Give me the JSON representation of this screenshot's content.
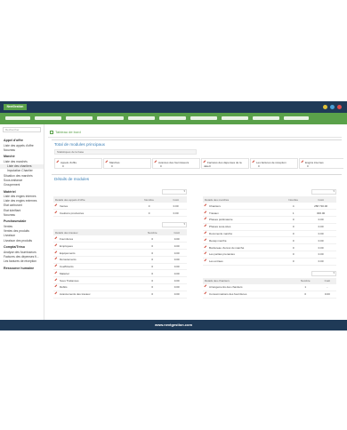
{
  "brand": {
    "name": "NextGestion",
    "accent": "#5aa14a",
    "dark": "#1f3a57"
  },
  "window_dots": [
    "#e0c13a",
    "#4aa0d6",
    "#e14b4b"
  ],
  "sidebar": {
    "search_placeholder": "Rechercher",
    "sections": [
      {
        "title": "Appel d'offre",
        "links": [
          "Liste des appels d'offre",
          "Nouveau"
        ]
      },
      {
        "title": "Marché",
        "links": [
          "Liste des marchés",
          "Liste des chantiers",
          "Imputation Chantier",
          "Situation des marchés",
          "Sous-traitance",
          "Groupement"
        ]
      },
      {
        "title": "Matériel",
        "links": [
          "Liste des engins internes",
          "Liste des engins externes",
          "Etat carburant",
          "Etat lubrifiant",
          "Nouveau"
        ]
      },
      {
        "title": "Purchasesdale",
        "links": [
          "Ventes",
          "Ventes des produits",
          "Livraison",
          "Livraison des produits"
        ]
      },
      {
        "title": "Compta/Tréso",
        "links": [
          "Analyse des fournisseurs",
          "Factures des dépenses fi...",
          "Les factures de réception"
        ]
      },
      {
        "title": "Ressource humaine",
        "links": []
      }
    ]
  },
  "main": {
    "breadcrumb": "Tableau de bord",
    "overview": {
      "title": "Total de modules principaux",
      "hint": "Statistiques de la base",
      "modules": [
        {
          "label": "Appels d'offre",
          "value": "0"
        },
        {
          "label": "Marchés",
          "value": "0"
        },
        {
          "label": "Avances des fournisseurs",
          "value": "0"
        },
        {
          "label": "Factures des dépenses de la date",
          "value": "0"
        },
        {
          "label": "Les factures de réception",
          "value": "0"
        },
        {
          "label": "Engins internes",
          "value": "0"
        },
        {
          "label": "Engins externes",
          "value": "0"
        }
      ]
    },
    "details": {
      "title": "Détails de modules",
      "left_tables": [
        {
          "headers": [
            "Détails des appels d'offre",
            "Nombre",
            "Coût"
          ],
          "rows": [
            [
              "Ventes",
              "0",
              "0.00"
            ],
            [
              "Cautions provisoires",
              "0",
              "0.00"
            ]
          ]
        },
        {
          "headers": [
            "Détails des travaux",
            "Nombre",
            "Coût"
          ],
          "rows": [
            [
              "Fournitures",
              "0",
              "0.00"
            ],
            [
              "Employées",
              "0",
              "0.00"
            ],
            [
              "Equipements",
              "0",
              "0.00"
            ],
            [
              "Déroulements",
              "0",
              "0.00"
            ],
            [
              "Coefficients",
              "0",
              "0.00"
            ],
            [
              "Matériel",
              "0",
              "0.00"
            ],
            [
              "Sous Traitances",
              "0",
              "0.00"
            ],
            [
              "Débits",
              "0",
              "0.00"
            ],
            [
              "Avancements des travaux",
              "0",
              "0.00"
            ]
          ]
        }
      ],
      "right_tables": [
        {
          "headers": [
            "Détails des marchés",
            "Nombre",
            "Coût"
          ],
          "rows": [
            [
              "Chantiers",
              "4",
              "258 730.00"
            ],
            [
              "Travaux",
              "1",
              "300.00"
            ],
            [
              "Phases prélimatoire",
              "0",
              "0.00"
            ],
            [
              "Phases sous-sites",
              "0",
              "0.00"
            ],
            [
              "Documents marché",
              "0",
              "0.00"
            ],
            [
              "Recap marché",
              "0",
              "0.00"
            ],
            [
              "Bordereau d'envoi du marché",
              "0",
              "0.00"
            ],
            [
              "Les parties prenantes",
              "0",
              "0.00"
            ],
            [
              "Les entrées",
              "0",
              "0.00"
            ]
          ]
        },
        {
          "headers": [
            "Détails des chantiers",
            "Nombre",
            "Coût"
          ],
          "rows": [
            [
              "Arrangements des chantiers",
              "1",
              "-"
            ],
            [
              "Consommations des fournitures",
              "0",
              "0.00"
            ]
          ]
        }
      ]
    }
  },
  "footer": "www.nextgestion.com"
}
